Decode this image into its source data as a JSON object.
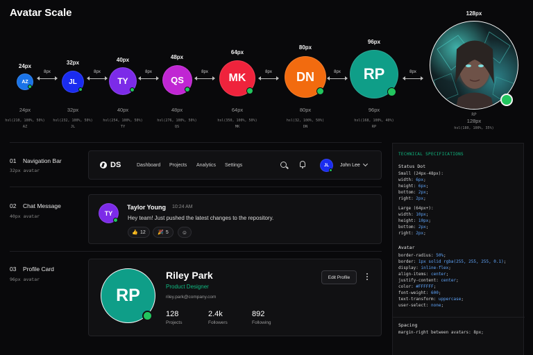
{
  "page_title": "Avatar Scale",
  "scale": [
    {
      "size": "24px",
      "initials": "AZ",
      "hsl": "hsl(210, 100%, 50%)",
      "color": "#1a73e8"
    },
    {
      "size": "32px",
      "initials": "JL",
      "hsl": "hsl(232, 100%, 50%)",
      "color": "#1a2cf0"
    },
    {
      "size": "40px",
      "initials": "TY",
      "hsl": "hsl(254, 100%, 50%)",
      "color": "#7c2be8"
    },
    {
      "size": "48px",
      "initials": "QS",
      "hsl": "hsl(276, 100%, 50%)",
      "color": "#c026d3"
    },
    {
      "size": "64px",
      "initials": "MK",
      "hsl": "hsl(350, 100%, 50%)",
      "color": "#ef233c"
    },
    {
      "size": "80px",
      "initials": "DN",
      "hsl": "hsl(32, 100%, 50%)",
      "color": "#f26b0f"
    },
    {
      "size": "96px",
      "initials": "RP",
      "hsl": "hsl(168, 100%, 40%)",
      "color": "#0f9e88"
    }
  ],
  "portrait": {
    "size": "128px",
    "hsl": "hsl(180, 100%, 35%)",
    "initials": "RP"
  },
  "gap_label": "8px",
  "examples": [
    {
      "num": "01",
      "title": "Navigation Bar",
      "sub": "32px avatar"
    },
    {
      "num": "02",
      "title": "Chat Message",
      "sub": "40px avatar"
    },
    {
      "num": "03",
      "title": "Profile Card",
      "sub": "96px avatar"
    }
  ],
  "nav": {
    "brand": "DS",
    "links": [
      "Dashboard",
      "Projects",
      "Analytics",
      "Settings"
    ],
    "user_initials": "JL",
    "user_name": "John Lee"
  },
  "chat": {
    "initials": "TY",
    "name": "Taylor Young",
    "time": "10:24 AM",
    "message": "Hey team! Just pushed the latest changes to the repository.",
    "reactions": [
      {
        "emoji": "👍",
        "count": "12"
      },
      {
        "emoji": "🎉",
        "count": "5"
      }
    ],
    "add_reaction": "☺"
  },
  "profile": {
    "initials": "RP",
    "name": "Riley Park",
    "role": "Product Designer",
    "email": "riley.park@company.com",
    "edit_label": "Edit Profile",
    "stats": [
      {
        "value": "128",
        "label": "Projects"
      },
      {
        "value": "2.4k",
        "label": "Followers"
      },
      {
        "value": "892",
        "label": "Following"
      }
    ]
  },
  "spec": {
    "title": "TECHNICAL SPECIFICATIONS",
    "status_dot_heading": "Status Dot",
    "small_heading": "Small (24px-48px):",
    "small": [
      [
        "width",
        "6px"
      ],
      [
        "height",
        "6px"
      ],
      [
        "bottom",
        "2px"
      ],
      [
        "right",
        "2px"
      ]
    ],
    "large_heading": "Large (64px+):",
    "large": [
      [
        "width",
        "10px"
      ],
      [
        "height",
        "10px"
      ],
      [
        "bottom",
        "2px"
      ],
      [
        "right",
        "2px"
      ]
    ],
    "avatar_heading": "Avatar",
    "avatar": [
      [
        "border-radius",
        "50%"
      ],
      [
        "border",
        "1px solid rgba(255, 255, 255, 0.1)"
      ],
      [
        "display",
        "inline-flex"
      ],
      [
        "align-items",
        "center"
      ],
      [
        "justify-content",
        "center"
      ],
      [
        "color",
        "#FFFFFF"
      ],
      [
        "font-weight",
        "600"
      ],
      [
        "text-transform",
        "uppercase"
      ],
      [
        "user-select",
        "none"
      ]
    ],
    "spacing_heading": "Spacing",
    "spacing_line": "margin-right between avatars: 8px;"
  },
  "colors": {
    "accent_green": "#10b981",
    "status_green": "#22c55e",
    "profile_avatar": "#0f9e88"
  }
}
